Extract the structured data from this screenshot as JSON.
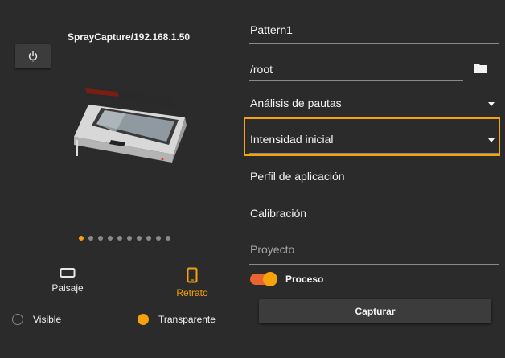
{
  "device": {
    "title": "SprayCapture/192.168.1.50",
    "power_icon": "power-icon",
    "image": "scanner-device-illustration"
  },
  "carousel": {
    "count": 10,
    "active_index": 0
  },
  "orientation": {
    "landscape_label": "Paisaje",
    "portrait_label": "Retrato",
    "selected": "portrait"
  },
  "background": {
    "visible_label": "Visible",
    "transparent_label": "Transparente",
    "selected": "transparent"
  },
  "form": {
    "pattern_name": "Pattern1",
    "path": "/root",
    "folder_icon": "folder-icon",
    "analysis_label": "Análisis de pautas",
    "intensity_label": "Intensidad inicial",
    "profile_label": "Perfil de aplicación",
    "calibration_label": "Calibración",
    "project_label": "Proyecto",
    "process_label": "Proceso",
    "process_on": true,
    "capture_label": "Capturar"
  },
  "colors": {
    "background": "#2b2b2b",
    "accent": "#f5a20b",
    "switch_track": "#e9642f"
  }
}
